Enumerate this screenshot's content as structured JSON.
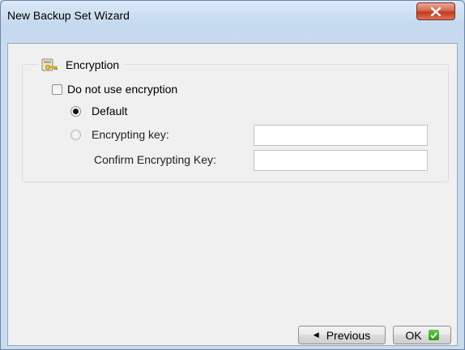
{
  "window": {
    "title": "New Backup Set Wizard",
    "close_icon": "close-icon"
  },
  "encryption": {
    "group_title": "Encryption",
    "group_icon": "key-icon",
    "no_encryption_label": "Do not use encryption",
    "no_encryption_checked": false,
    "default_label": "Default",
    "default_selected": true,
    "key_label": "Encrypting key:",
    "key_selected": false,
    "key_value": "",
    "confirm_label": "Confirm Encrypting Key:",
    "confirm_value": ""
  },
  "buttons": {
    "previous_label": "Previous",
    "previous_icon": "left-arrow-icon",
    "ok_label": "OK",
    "ok_icon": "check-icon"
  }
}
